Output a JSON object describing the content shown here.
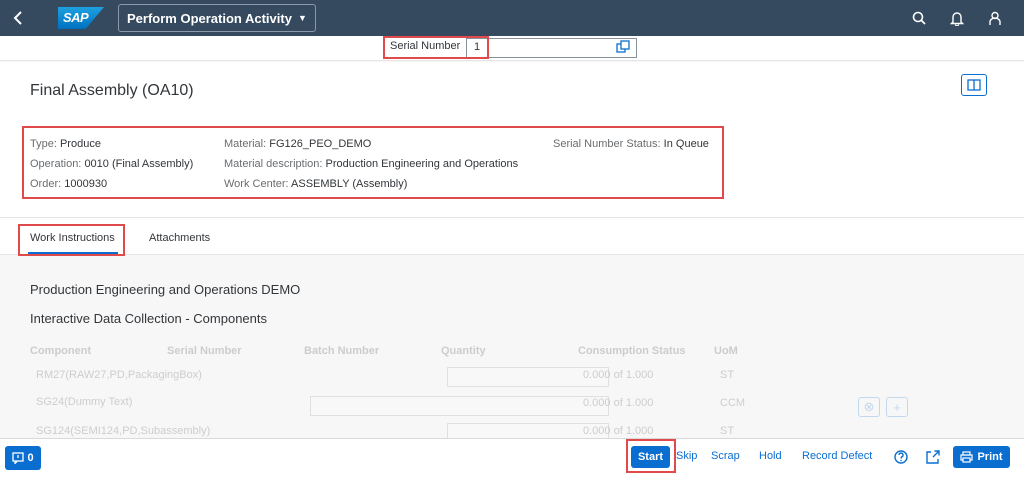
{
  "shell": {
    "logo_text": "SAP",
    "app_title": "Perform Operation Activity"
  },
  "serial": {
    "label": "Serial Number",
    "value": "1"
  },
  "header": {
    "title": "Final Assembly (OA10)",
    "type_key": "Type:",
    "type_val": "Produce",
    "operation_key": "Operation:",
    "operation_val": "0010 (Final Assembly)",
    "order_key": "Order:",
    "order_val": "1000930",
    "material_key": "Material:",
    "material_val": "FG126_PEO_DEMO",
    "matdesc_key": "Material description:",
    "matdesc_val": "Production Engineering and Operations",
    "workcenter_key": "Work Center:",
    "workcenter_val": "ASSEMBLY (Assembly)",
    "sn_status_key": "Serial Number Status:",
    "sn_status_val": "In Queue"
  },
  "tabs": [
    "Work Instructions",
    "Attachments"
  ],
  "content": {
    "title1": "Production Engineering and Operations DEMO",
    "title2": "Interactive Data Collection - Components",
    "columns": [
      "Component",
      "Serial Number",
      "Batch Number",
      "Quantity",
      "Consumption Status",
      "UoM"
    ],
    "rows": [
      {
        "component": "RM27(RAW27,PD,PackagingBox)",
        "status": "0.000 of 1.000",
        "uom": "ST"
      },
      {
        "component": "SG24(Dummy Text)",
        "status": "0.000 of 1.000",
        "uom": "CCM"
      },
      {
        "component": "SG124(SEMI124,PD,Subassembly)",
        "status": "0.000 of 1.000",
        "uom": "ST"
      }
    ]
  },
  "footer": {
    "message_count": "0",
    "start": "Start",
    "skip": "Skip",
    "scrap": "Scrap",
    "hold": "Hold",
    "record_defect": "Record Defect",
    "print": "Print"
  },
  "colors": {
    "shell": "#354a5f",
    "accent": "#0a6ed1",
    "highlight": "#e04a4a"
  },
  "icons": [
    "back-icon",
    "search-icon",
    "bell-icon",
    "user-icon",
    "copy-icon",
    "layout-icon",
    "message-icon",
    "help-icon",
    "share-icon",
    "print-icon",
    "clear-icon",
    "add-icon"
  ]
}
